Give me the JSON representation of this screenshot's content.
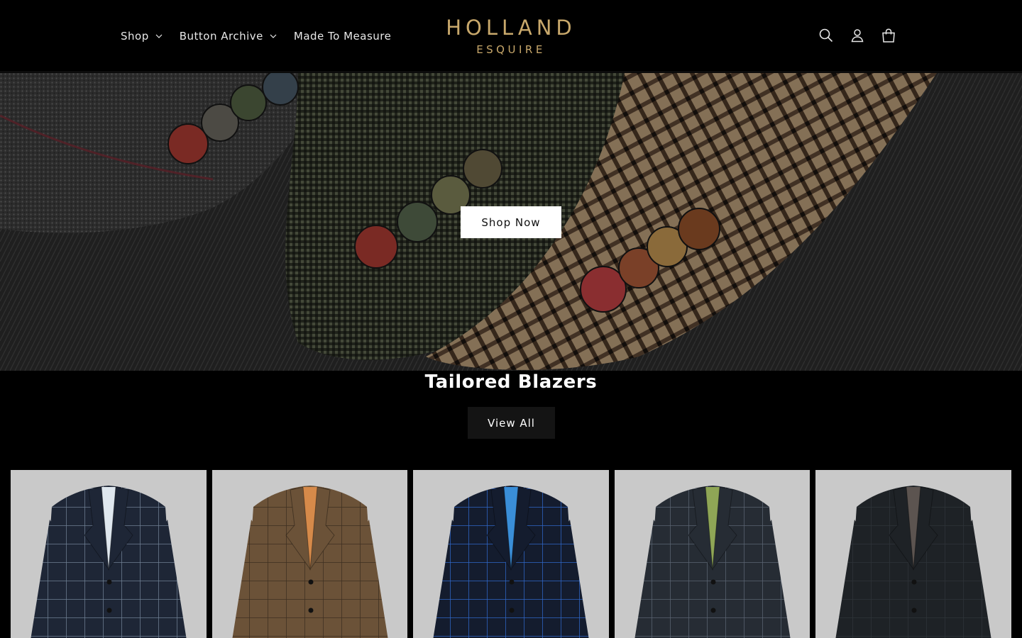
{
  "header": {
    "nav": [
      {
        "label": "Shop",
        "has_dropdown": true
      },
      {
        "label": "Button Archive",
        "has_dropdown": true
      },
      {
        "label": "Made To Measure",
        "has_dropdown": false
      }
    ],
    "logo": {
      "main": "HOLLAND",
      "sub": "ESQUIRE"
    },
    "icons": [
      "search-icon",
      "account-icon",
      "cart-icon"
    ],
    "accent_color": "#c8a86b"
  },
  "hero": {
    "button_label": "Shop Now"
  },
  "collection": {
    "title": "Tailored Blazers",
    "view_all_label": "View All",
    "products": [
      {
        "fabric": "#1e2636",
        "lining": "#dfe7ee",
        "check": "#6f7f93"
      },
      {
        "fabric": "#6b5238",
        "lining": "#d68a4a",
        "check": "#3d2e20"
      },
      {
        "fabric": "#141c2e",
        "lining": "#3a8ed8",
        "check": "#2f66c8"
      },
      {
        "fabric": "#262c34",
        "lining": "#8fa656",
        "check": "#5a6472"
      },
      {
        "fabric": "#1e2226",
        "lining": "#5c5450",
        "check": "#2e3338"
      }
    ]
  }
}
